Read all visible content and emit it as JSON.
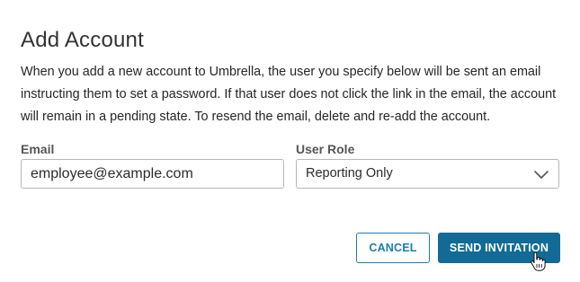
{
  "dialog": {
    "title": "Add Account",
    "description": "When you add a new account to Umbrella, the user you specify below will be sent an email instructing them to set a password. If that user does not click the link in the email, the account will remain in a pending state. To resend the email, delete and re-add the account."
  },
  "form": {
    "email_label": "Email",
    "email_value": "employee@example.com",
    "role_label": "User Role",
    "role_value": "Reporting Only",
    "role_icon": "chevron-down-icon"
  },
  "actions": {
    "cancel_label": "CANCEL",
    "send_label": "SEND INVITATION"
  },
  "colors": {
    "primary": "#126b96",
    "primary_outline": "#1a7fb0",
    "input_border": "#b7b7b7"
  },
  "cursor": "hand-pointer-icon"
}
